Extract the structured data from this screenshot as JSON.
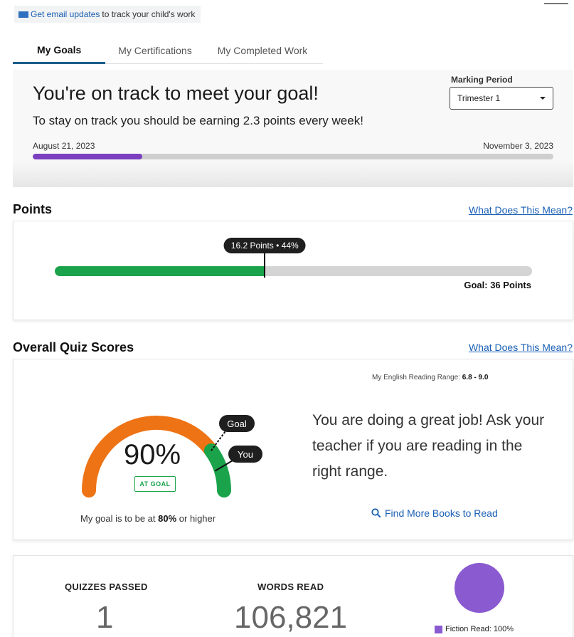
{
  "banner": {
    "link_text": "Get email updates",
    "rest_text": "to track your child's work",
    "icon": "mail-icon"
  },
  "tabs": [
    {
      "label": "My Goals",
      "active": true
    },
    {
      "label": "My Certifications",
      "active": false
    },
    {
      "label": "My Completed Work",
      "active": false
    }
  ],
  "goal_panel": {
    "title": "You're on track to meet your goal!",
    "subtitle": "To stay on track you should be earning 2.3 points every week!",
    "marking_period_label": "Marking Period",
    "marking_period_value": "Trimester 1",
    "start_date": "August 21, 2023",
    "end_date": "November 3, 2023",
    "progress_fraction": 0.21,
    "progress_color": "#7b3fbf"
  },
  "points": {
    "section_title": "Points",
    "help_link": "What Does This Mean?",
    "badge": "16.2 Points • 44%",
    "progress_fraction": 0.44,
    "goal_text": "Goal: 36 Points",
    "fill_color": "#1aa34a"
  },
  "quiz": {
    "section_title": "Overall Quiz Scores",
    "help_link": "What Does This Mean?",
    "range_label": "My English Reading Range:",
    "range_value": "6.8 - 9.0",
    "score_percent": "90%",
    "score_fraction": 0.9,
    "goal_fraction": 0.8,
    "status_badge": "AT GOAL",
    "goal_label": "Goal",
    "you_label": "You",
    "goal_note_pre": "My goal is to be at",
    "goal_note_value": "80%",
    "goal_note_post": "or higher",
    "message": "You are doing a great job! Ask your teacher if you are reading in the right range.",
    "find_books": "Find More Books to Read",
    "gauge_orange": "#ee7314",
    "gauge_green": "#1aa34a"
  },
  "stats": {
    "quizzes_label": "QUIZZES PASSED",
    "quizzes_value": "1",
    "words_label": "WORDS READ",
    "words_value": "106,821",
    "fiction_legend": "Fiction Read: 100%",
    "fiction_fraction": 1.0,
    "pie_color": "#8a5ad0"
  }
}
